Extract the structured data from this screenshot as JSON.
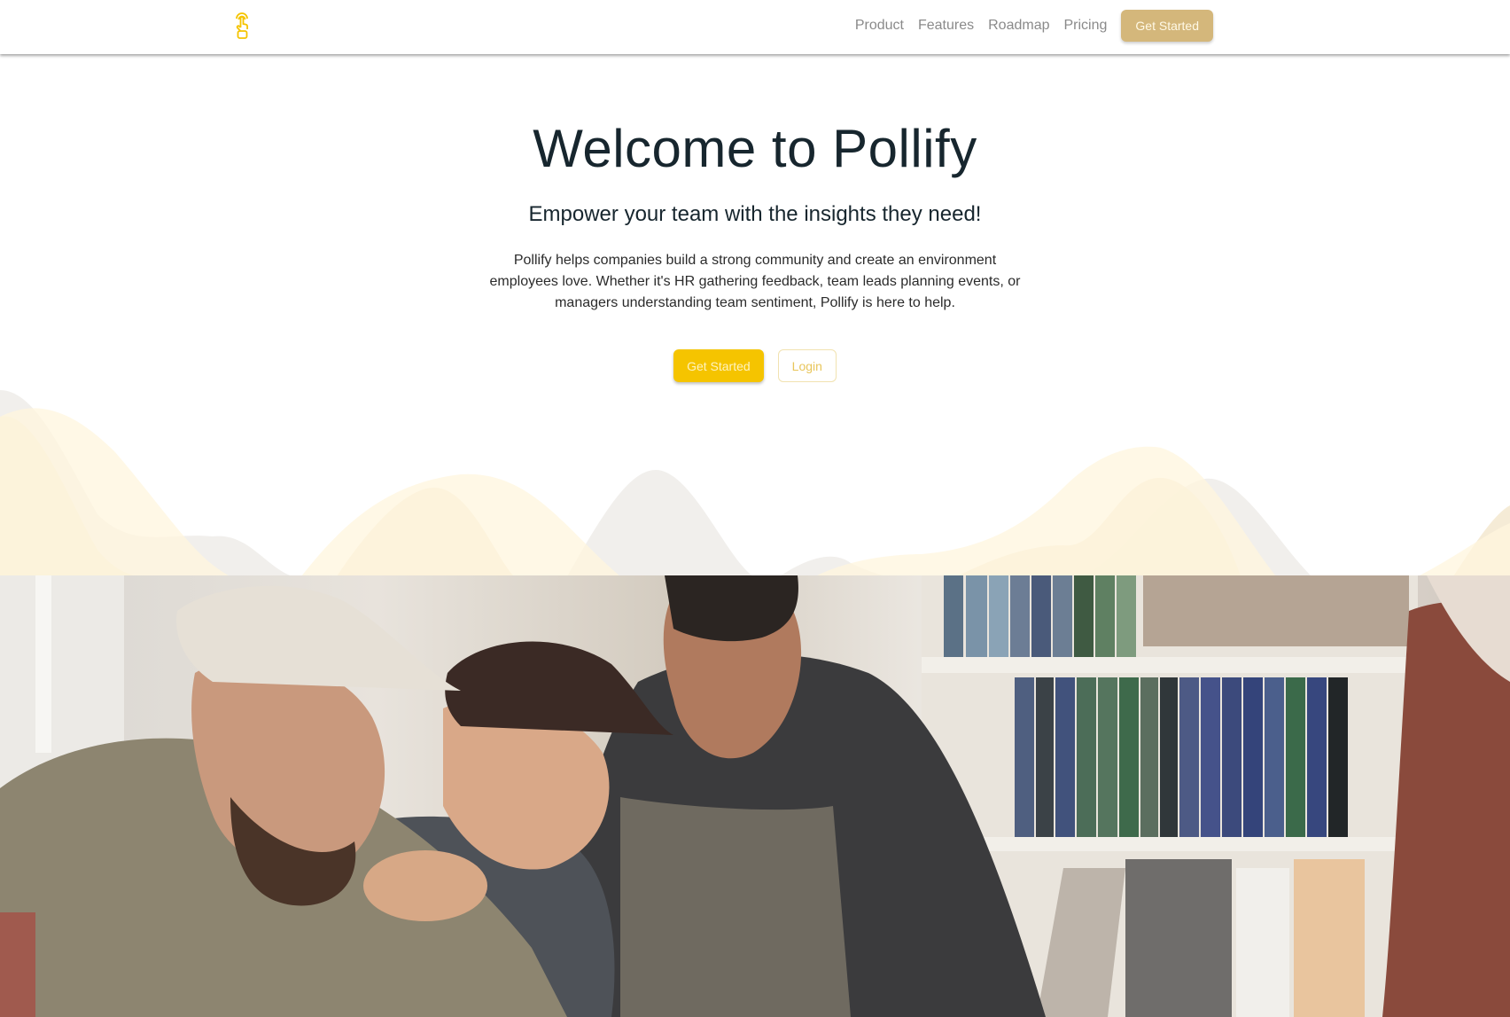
{
  "navbar": {
    "logo_icon": "hand-tap-icon",
    "links": [
      {
        "label": "Product"
      },
      {
        "label": "Features"
      },
      {
        "label": "Roadmap"
      },
      {
        "label": "Pricing"
      }
    ],
    "cta_label": "Get Started"
  },
  "hero": {
    "title": "Welcome to Pollify",
    "subtitle": "Empower your team with the insights they need!",
    "description": "Pollify helps companies build a strong community and create an environment employees love. Whether it's HR gathering feedback, team leads planning events, or managers understanding team sentiment, Pollify is here to help.",
    "primary_button": "Get Started",
    "secondary_button": "Login"
  },
  "colors": {
    "brand_yellow": "#f5c400",
    "nav_cta": "#d4b77b",
    "heading": "#17262e",
    "wave_light": "#fff7e0",
    "wave_tan": "#f3e8cf",
    "wave_gray": "#efedea"
  },
  "photo": {
    "description": "Group of people laughing together around a laptop in front of bookshelves"
  }
}
